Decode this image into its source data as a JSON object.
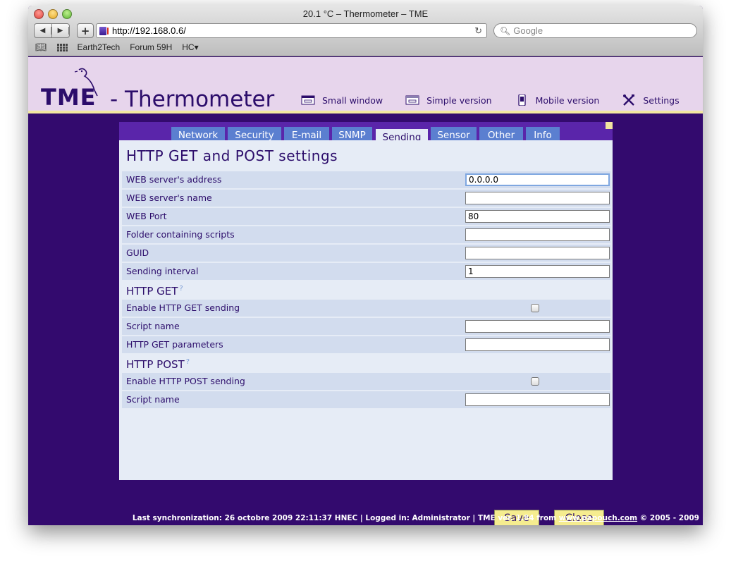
{
  "browser": {
    "window_title": "20.1 °C – Thermometer – TME",
    "url": "http://192.168.0.6/",
    "search_placeholder": "Google",
    "bookmarks": [
      "Earth2Tech",
      "Forum 59H",
      "HC▾"
    ]
  },
  "header": {
    "logo": "TME",
    "title": "- Thermometer",
    "links": [
      {
        "label": "Small window",
        "icon": "small-window-icon"
      },
      {
        "label": "Simple version",
        "icon": "simple-version-icon"
      },
      {
        "label": "Mobile version",
        "icon": "mobile-icon"
      },
      {
        "label": "Settings",
        "icon": "settings-tools-icon"
      }
    ]
  },
  "tabs": [
    {
      "label": "Network",
      "active": false
    },
    {
      "label": "Security",
      "active": false
    },
    {
      "label": "E-mail",
      "active": false
    },
    {
      "label": "SNMP",
      "active": false
    },
    {
      "label": "Sending",
      "active": true
    },
    {
      "label": "Sensor",
      "active": false
    },
    {
      "label": "Other",
      "active": false
    },
    {
      "label": "Info",
      "active": false
    }
  ],
  "form": {
    "title": "HTTP GET and POST settings",
    "general_rows": [
      {
        "label": "WEB server's address",
        "value": "0.0.0.0"
      },
      {
        "label": "WEB server's name",
        "value": ""
      },
      {
        "label": "WEB Port",
        "value": "80"
      },
      {
        "label": "Folder containing scripts",
        "value": ""
      },
      {
        "label": "GUID",
        "value": ""
      },
      {
        "label": "Sending interval",
        "value": "1"
      }
    ],
    "get_section": {
      "title": "HTTP GET",
      "help": "?",
      "enable_label": "Enable HTTP GET sending",
      "enabled": false,
      "rows": [
        {
          "label": "Script name",
          "value": ""
        },
        {
          "label": "HTTP GET parameters",
          "value": ""
        }
      ]
    },
    "post_section": {
      "title": "HTTP POST",
      "help": "?",
      "enable_label": "Enable HTTP POST sending",
      "enabled": false,
      "rows": [
        {
          "label": "Script name",
          "value": ""
        }
      ]
    },
    "save_label": "Save",
    "close_label": "Close"
  },
  "footer": {
    "text_before": "Last synchronization: 26 octobre 2009 22:11:37 HNEC | Logged in: Administrator | TME ver. 1.84 from ",
    "link": "www.papouch.com",
    "text_after": " © 2005 - 2009"
  }
}
